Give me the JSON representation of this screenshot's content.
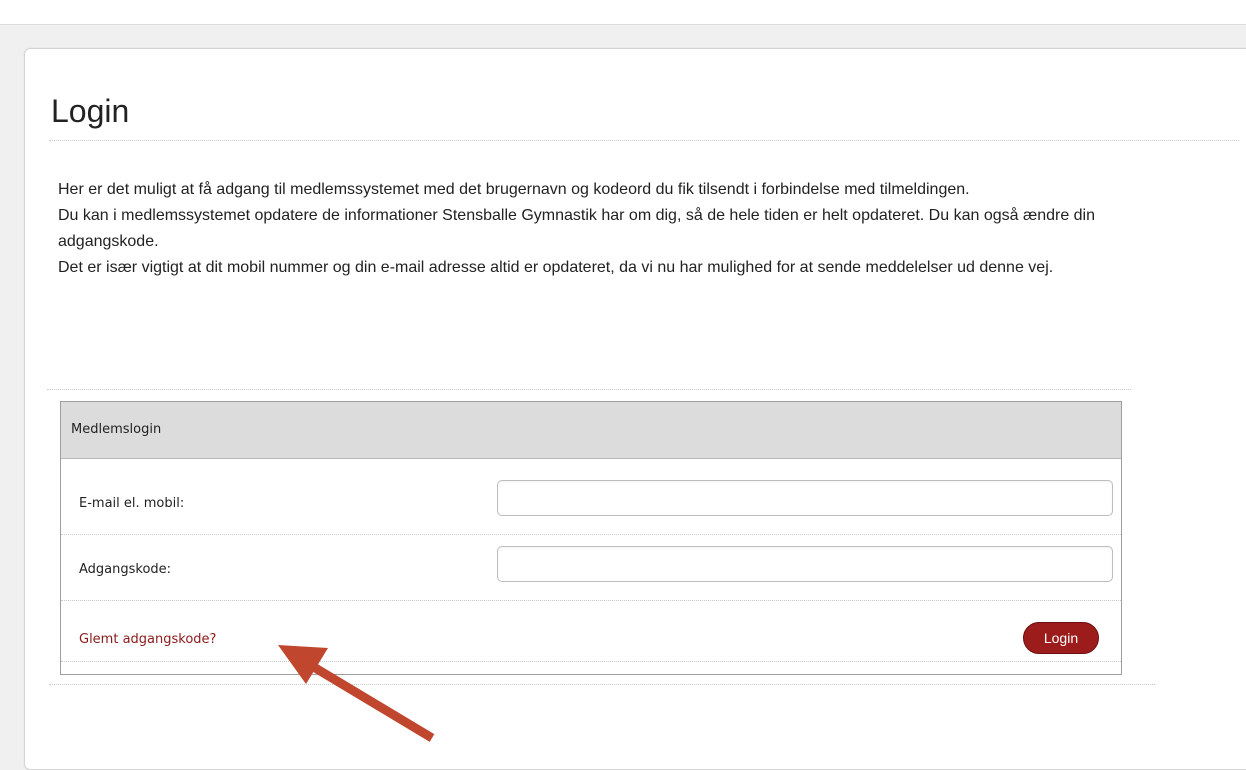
{
  "page": {
    "title": "Login"
  },
  "intro": {
    "paragraphs": [
      "Her er det muligt at få adgang til medlemssystemet med det brugernavn og kodeord du fik tilsendt i forbindelse med tilmeldingen.",
      "Du kan i medlemssystemet opdatere de informationer Stensballe Gymnastik har om dig, så de hele tiden er helt opdateret. Du kan også ændre din adgangskode.",
      "Det er især vigtigt at dit mobil nummer og din e-mail adresse altid er opdateret, da vi nu har mulighed for at sende meddelelser ud denne vej."
    ]
  },
  "login_box": {
    "header": "Medlemslogin",
    "email_label": "E-mail el. mobil:",
    "email_value": "",
    "password_label": "Adgangskode:",
    "password_value": "",
    "forgot_link": "Glemt adgangskode?",
    "login_button": "Login"
  },
  "annotation": {
    "arrow_icon": "arrow-annotation-icon",
    "arrow_color": "#c0462e"
  },
  "colors": {
    "link": "#8b1a1a",
    "button_bg": "#9c1c1c",
    "header_bg": "#dcdcdc"
  }
}
